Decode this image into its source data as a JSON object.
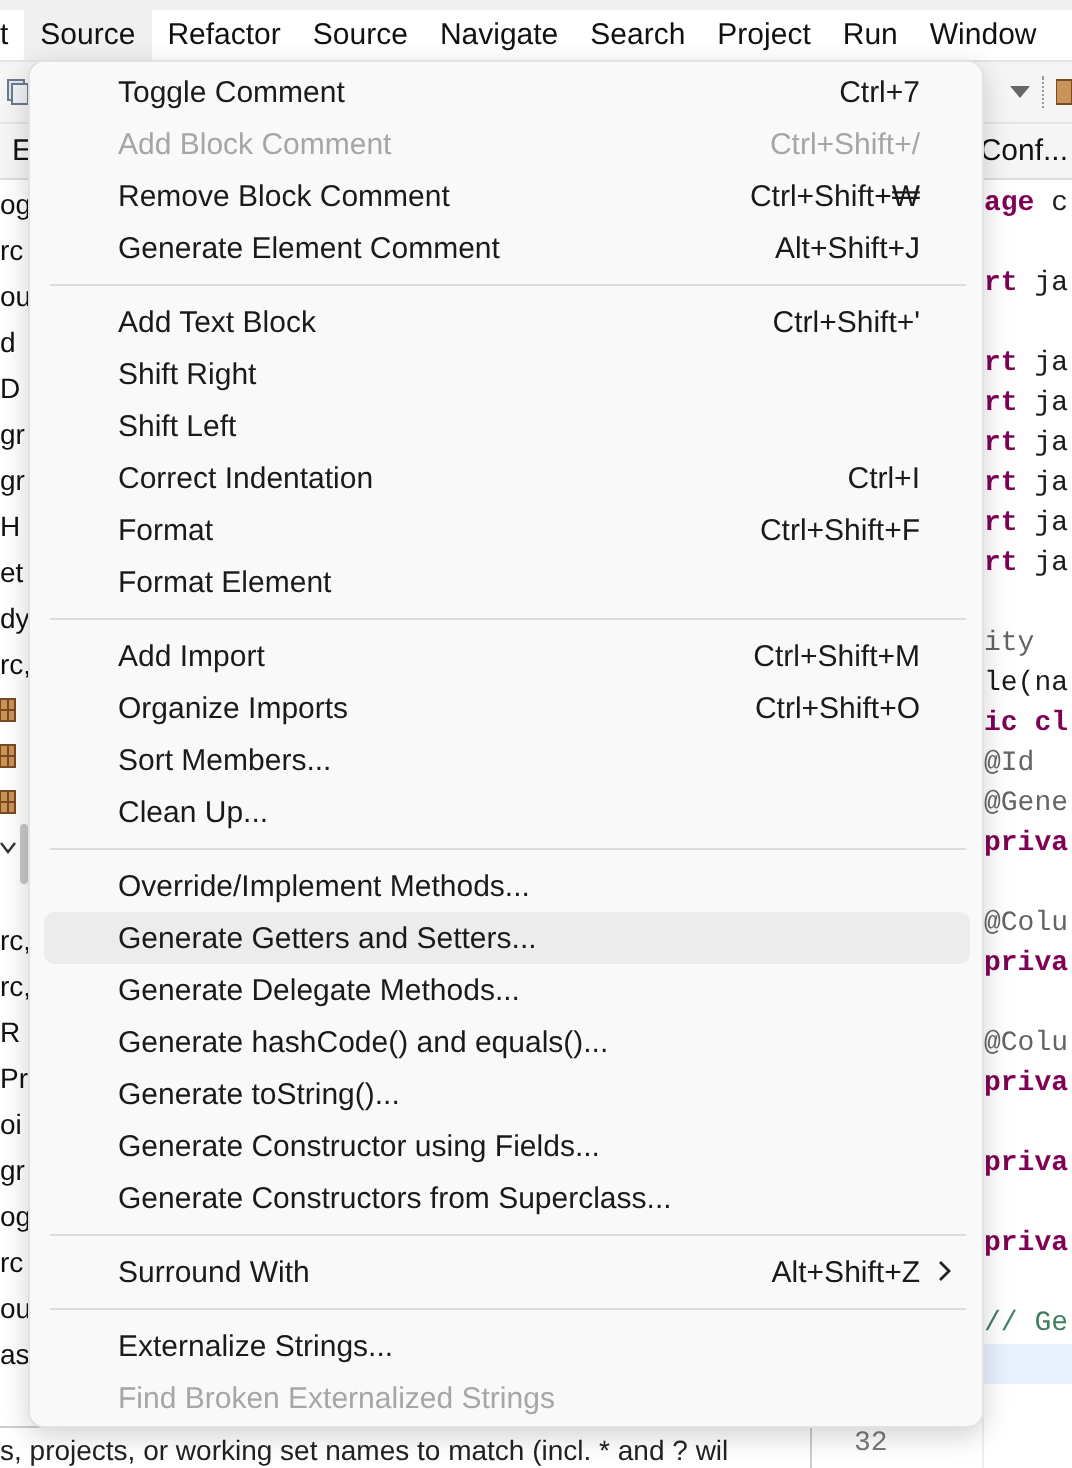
{
  "menubar": [
    {
      "label": "t",
      "selected": false
    },
    {
      "label": "Source",
      "selected": true
    },
    {
      "label": "Refactor",
      "selected": false
    },
    {
      "label": "Source",
      "selected": false
    },
    {
      "label": "Navigate",
      "selected": false
    },
    {
      "label": "Search",
      "selected": false
    },
    {
      "label": "Project",
      "selected": false
    },
    {
      "label": "Run",
      "selected": false
    },
    {
      "label": "Window",
      "selected": false
    }
  ],
  "tabs": {
    "left": "E",
    "right": "Conf..."
  },
  "explorer": {
    "items": [
      {
        "kind": "text",
        "text": "og"
      },
      {
        "kind": "text",
        "text": "rc"
      },
      {
        "kind": "text",
        "text": "ou"
      },
      {
        "kind": "text",
        "text": "d"
      },
      {
        "kind": "text",
        "text": "D"
      },
      {
        "kind": "text",
        "text": "gr"
      },
      {
        "kind": "text",
        "text": "gr"
      },
      {
        "kind": "text",
        "text": "H"
      },
      {
        "kind": "text",
        "text": "et"
      },
      {
        "kind": "text",
        "text": "dy"
      },
      {
        "kind": "text",
        "text": "rc,"
      },
      {
        "kind": "package"
      },
      {
        "kind": "package"
      },
      {
        "kind": "package"
      },
      {
        "kind": "expander"
      },
      {
        "kind": "blank"
      },
      {
        "kind": "text",
        "text": "rc,"
      },
      {
        "kind": "text",
        "text": "rc,"
      },
      {
        "kind": "text",
        "text": "R"
      },
      {
        "kind": "text",
        "text": "Pr"
      },
      {
        "kind": "text",
        "text": "oi"
      },
      {
        "kind": "text",
        "text": "gr"
      },
      {
        "kind": "text",
        "text": "og"
      },
      {
        "kind": "text",
        "text": "rc"
      },
      {
        "kind": "text",
        "text": "ou"
      },
      {
        "kind": "text",
        "text": "as"
      }
    ],
    "filter": "s, projects, or working set names to match (incl. * and ? wil"
  },
  "editor": {
    "line_number": "32",
    "lines": [
      {
        "kind": "keyword",
        "keyword": "age",
        "text": " c"
      },
      {
        "kind": "blank"
      },
      {
        "kind": "keyword",
        "keyword": "rt",
        "text": " ja"
      },
      {
        "kind": "blank"
      },
      {
        "kind": "keyword",
        "keyword": "rt",
        "text": " ja"
      },
      {
        "kind": "keyword",
        "keyword": "rt",
        "text": " ja"
      },
      {
        "kind": "keyword",
        "keyword": "rt",
        "text": " ja"
      },
      {
        "kind": "keyword",
        "keyword": "rt",
        "text": " ja"
      },
      {
        "kind": "keyword",
        "keyword": "rt",
        "text": " ja"
      },
      {
        "kind": "keyword",
        "keyword": "rt",
        "text": " ja"
      },
      {
        "kind": "blank"
      },
      {
        "kind": "annotation",
        "text": "ity"
      },
      {
        "kind": "plain",
        "text": "le(na"
      },
      {
        "kind": "keyword",
        "keyword": "ic cl"
      },
      {
        "kind": "annotation",
        "text": "@Id"
      },
      {
        "kind": "annotation",
        "text": "@Gene"
      },
      {
        "kind": "keyword",
        "keyword": "priva"
      },
      {
        "kind": "blank"
      },
      {
        "kind": "annotation",
        "text": "@Colu"
      },
      {
        "kind": "keyword",
        "keyword": "priva"
      },
      {
        "kind": "blank"
      },
      {
        "kind": "annotation",
        "text": "@Colu"
      },
      {
        "kind": "keyword",
        "keyword": "priva"
      },
      {
        "kind": "blank"
      },
      {
        "kind": "keyword",
        "keyword": "priva"
      },
      {
        "kind": "blank"
      },
      {
        "kind": "keyword",
        "keyword": "priva"
      },
      {
        "kind": "blank"
      },
      {
        "kind": "comment",
        "text": "// Ge"
      },
      {
        "kind": "current"
      }
    ]
  },
  "context_menu": {
    "groups": [
      [
        {
          "label": "Toggle Comment",
          "shortcut": "Ctrl+7",
          "disabled": false,
          "selected": false
        },
        {
          "label": "Add Block Comment",
          "shortcut": "Ctrl+Shift+/",
          "disabled": true,
          "selected": false
        },
        {
          "label": "Remove Block Comment",
          "shortcut": "Ctrl+Shift+₩",
          "disabled": false,
          "selected": false
        },
        {
          "label": "Generate Element Comment",
          "shortcut": "Alt+Shift+J",
          "disabled": false,
          "selected": false
        }
      ],
      [
        {
          "label": "Add Text Block",
          "shortcut": "Ctrl+Shift+'",
          "disabled": false,
          "selected": false
        },
        {
          "label": "Shift Right",
          "disabled": false,
          "selected": false
        },
        {
          "label": "Shift Left",
          "disabled": false,
          "selected": false
        },
        {
          "label": "Correct Indentation",
          "shortcut": "Ctrl+I",
          "disabled": false,
          "selected": false
        },
        {
          "label": "Format",
          "shortcut": "Ctrl+Shift+F",
          "disabled": false,
          "selected": false
        },
        {
          "label": "Format Element",
          "disabled": false,
          "selected": false
        }
      ],
      [
        {
          "label": "Add Import",
          "shortcut": "Ctrl+Shift+M",
          "disabled": false,
          "selected": false
        },
        {
          "label": "Organize Imports",
          "shortcut": "Ctrl+Shift+O",
          "disabled": false,
          "selected": false
        },
        {
          "label": "Sort Members...",
          "disabled": false,
          "selected": false
        },
        {
          "label": "Clean Up...",
          "disabled": false,
          "selected": false
        }
      ],
      [
        {
          "label": "Override/Implement Methods...",
          "disabled": false,
          "selected": false
        },
        {
          "label": "Generate Getters and Setters...",
          "disabled": false,
          "selected": true
        },
        {
          "label": "Generate Delegate Methods...",
          "disabled": false,
          "selected": false
        },
        {
          "label": "Generate hashCode() and equals()...",
          "disabled": false,
          "selected": false
        },
        {
          "label": "Generate toString()...",
          "disabled": false,
          "selected": false
        },
        {
          "label": "Generate Constructor using Fields...",
          "disabled": false,
          "selected": false
        },
        {
          "label": "Generate Constructors from Superclass...",
          "disabled": false,
          "selected": false
        }
      ],
      [
        {
          "label": "Surround With",
          "shortcut": "Alt+Shift+Z",
          "submenu": true,
          "disabled": false,
          "selected": false
        }
      ],
      [
        {
          "label": "Externalize Strings...",
          "disabled": false,
          "selected": false
        },
        {
          "label": "Find Broken Externalized Strings",
          "disabled": true,
          "selected": false
        }
      ]
    ]
  }
}
